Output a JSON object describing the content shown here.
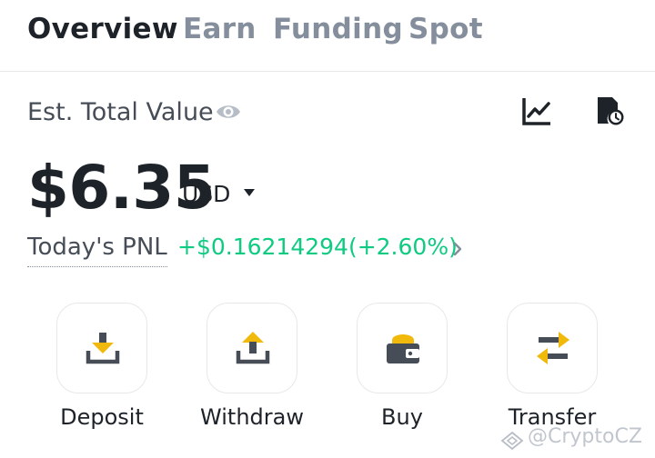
{
  "tabs": [
    {
      "label": "Overview",
      "active": true
    },
    {
      "label": "Earn",
      "active": false
    },
    {
      "label": "Funding",
      "active": false
    },
    {
      "label": "Spot",
      "active": false
    }
  ],
  "balance": {
    "label": "Est. Total Value",
    "amount": "$6.35",
    "currency": "USD"
  },
  "pnl": {
    "label": "Today's PNL",
    "value": "+$0.16214294(+2.60%)"
  },
  "actions": [
    {
      "label": "Deposit",
      "icon": "deposit-icon"
    },
    {
      "label": "Withdraw",
      "icon": "withdraw-icon"
    },
    {
      "label": "Buy",
      "icon": "wallet-icon"
    },
    {
      "label": "Transfer",
      "icon": "transfer-icon"
    }
  ],
  "watermark": "@CryptoCZ",
  "colors": {
    "accent": "#f0b90b",
    "positive": "#0ecb81",
    "text_primary": "#1e2329",
    "text_secondary": "#848e9c",
    "icon_dark": "#474d57"
  }
}
